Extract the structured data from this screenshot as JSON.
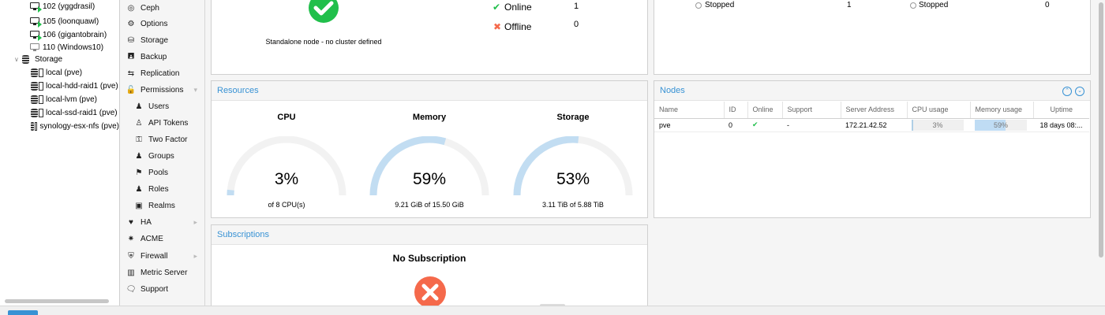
{
  "tree": {
    "items": [
      {
        "label": "102 (yggdrasil)",
        "icon": "vm-running-icon"
      },
      {
        "label": "105 (loonquawl)",
        "icon": "vm-running-icon"
      },
      {
        "label": "106 (gigantobrain)",
        "icon": "vm-running-icon"
      },
      {
        "label": "110 (Windows10)",
        "icon": "vm-stopped-icon"
      },
      {
        "label": "Storage",
        "icon": "storage-folder-icon"
      },
      {
        "label": "local (pve)",
        "icon": "storage-icon"
      },
      {
        "label": "local-hdd-raid1 (pve)",
        "icon": "storage-icon"
      },
      {
        "label": "local-lvm (pve)",
        "icon": "storage-icon"
      },
      {
        "label": "local-ssd-raid1 (pve)",
        "icon": "storage-icon"
      },
      {
        "label": "synology-esx-nfs (pve)",
        "icon": "storage-icon"
      }
    ]
  },
  "menu": {
    "items": [
      {
        "label": "Ceph",
        "icon": "ceph-icon"
      },
      {
        "label": "Options",
        "icon": "gear-icon"
      },
      {
        "label": "Storage",
        "icon": "database-icon"
      },
      {
        "label": "Backup",
        "icon": "floppy-icon"
      },
      {
        "label": "Replication",
        "icon": "retweet-icon"
      },
      {
        "label": "Permissions",
        "icon": "unlock-icon"
      },
      {
        "label": "Users",
        "icon": "user-icon"
      },
      {
        "label": "API Tokens",
        "icon": "user-outline-icon"
      },
      {
        "label": "Two Factor",
        "icon": "key-icon"
      },
      {
        "label": "Groups",
        "icon": "users-icon"
      },
      {
        "label": "Pools",
        "icon": "tags-icon"
      },
      {
        "label": "Roles",
        "icon": "male-icon"
      },
      {
        "label": "Realms",
        "icon": "address-book-icon"
      },
      {
        "label": "HA",
        "icon": "heartbeat-icon"
      },
      {
        "label": "ACME",
        "icon": "certificate-icon"
      },
      {
        "label": "Firewall",
        "icon": "shield-icon"
      },
      {
        "label": "Metric Server",
        "icon": "bar-chart-icon"
      },
      {
        "label": "Support",
        "icon": "comments-icon"
      }
    ]
  },
  "health": {
    "message": "Standalone node - no cluster defined",
    "status_icon": "check-circle-icon",
    "status_color": "#21bf4b",
    "online_label": "Online",
    "online_count": "1",
    "offline_label": "Offline",
    "offline_count": "0"
  },
  "guests": {
    "vm_stopped_label": "Stopped",
    "vm_stopped_count": "1",
    "ct_stopped_label": "Stopped",
    "ct_stopped_count": "0"
  },
  "resources": {
    "title": "Resources",
    "gauges": [
      {
        "title": "CPU",
        "value": "3%",
        "fraction": 0.03,
        "detail": "of 8 CPU(s)"
      },
      {
        "title": "Memory",
        "value": "59%",
        "fraction": 0.59,
        "detail": "9.21 GiB of 15.50 GiB"
      },
      {
        "title": "Storage",
        "value": "53%",
        "fraction": 0.53,
        "detail": "3.11 TiB of 5.88 TiB"
      }
    ],
    "gauge_color": "#c2ddf2",
    "gauge_track_color": "#f2f2f2"
  },
  "nodes": {
    "title": "Nodes",
    "columns": [
      "Name",
      "ID",
      "Online",
      "Support",
      "Server Address",
      "CPU usage",
      "Memory usage",
      "Uptime"
    ],
    "rows": [
      {
        "name": "pve",
        "id": "0",
        "online_icon": "check-icon",
        "support": "-",
        "address": "172.21.42.52",
        "cpu": "3%",
        "cpu_fraction": 0.03,
        "memory": "59%",
        "memory_fraction": 0.59,
        "uptime": "18 days 08:..."
      }
    ]
  },
  "subscriptions": {
    "title": "Subscriptions",
    "status": "No Subscription",
    "status_icon": "times-circle-icon",
    "status_color": "#f5694b"
  },
  "colors": {
    "accent": "#3892d4",
    "online": "#21bf4b",
    "offline": "#f5694b"
  }
}
